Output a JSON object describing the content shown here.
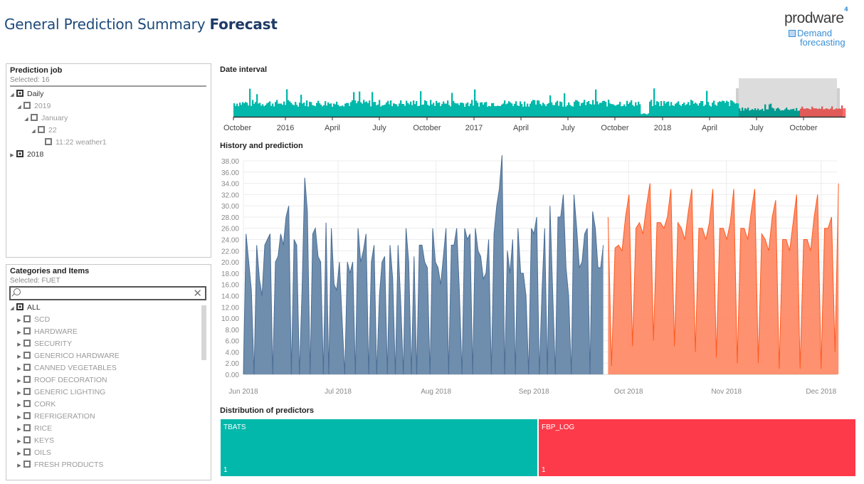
{
  "header": {
    "title_regular": "General Prediction Summary ",
    "title_bold": "Forecast"
  },
  "logo": {
    "brand": "prodware",
    "product_line1": "Demand",
    "product_line2": "forecasting"
  },
  "prediction_job": {
    "title": "Prediction job",
    "selected": "Selected: 16",
    "tree": [
      {
        "label": "Daily",
        "level": 0,
        "toggle": "expanded",
        "state": "partial",
        "dim": false
      },
      {
        "label": "2019",
        "level": 1,
        "toggle": "expanded",
        "state": "unchecked",
        "dim": true
      },
      {
        "label": "January",
        "level": 2,
        "toggle": "expanded",
        "state": "unchecked",
        "dim": true
      },
      {
        "label": "22",
        "level": 3,
        "toggle": "expanded",
        "state": "unchecked",
        "dim": true
      },
      {
        "label": "11:22 weather1",
        "level": 4,
        "toggle": "none",
        "state": "unchecked",
        "dim": true
      },
      {
        "label": "2018",
        "level": 0,
        "toggle": "collapsed",
        "state": "partial",
        "dim": false
      }
    ]
  },
  "categories": {
    "title": "Categories and Items",
    "selected": "Selected: FUET",
    "search_placeholder": "",
    "tree": [
      {
        "label": "ALL",
        "level": 0,
        "toggle": "expanded",
        "state": "partial",
        "dim": false
      },
      {
        "label": "SCD",
        "level": 1,
        "toggle": "collapsed",
        "state": "unchecked",
        "dim": true
      },
      {
        "label": "HARDWARE",
        "level": 1,
        "toggle": "collapsed",
        "state": "unchecked",
        "dim": true
      },
      {
        "label": "SECURITY",
        "level": 1,
        "toggle": "collapsed",
        "state": "unchecked",
        "dim": true
      },
      {
        "label": "GENERICO HARDWARE",
        "level": 1,
        "toggle": "collapsed",
        "state": "unchecked",
        "dim": true
      },
      {
        "label": "CANNED VEGETABLES",
        "level": 1,
        "toggle": "collapsed",
        "state": "unchecked",
        "dim": true
      },
      {
        "label": "ROOF DECORATION",
        "level": 1,
        "toggle": "collapsed",
        "state": "unchecked",
        "dim": true
      },
      {
        "label": "GENERIC LIGHTING",
        "level": 1,
        "toggle": "collapsed",
        "state": "unchecked",
        "dim": true
      },
      {
        "label": "CORK",
        "level": 1,
        "toggle": "collapsed",
        "state": "unchecked",
        "dim": true
      },
      {
        "label": "REFRIGERATION",
        "level": 1,
        "toggle": "collapsed",
        "state": "unchecked",
        "dim": true
      },
      {
        "label": "RICE",
        "level": 1,
        "toggle": "collapsed",
        "state": "unchecked",
        "dim": true
      },
      {
        "label": "KEYS",
        "level": 1,
        "toggle": "collapsed",
        "state": "unchecked",
        "dim": true
      },
      {
        "label": "OILS",
        "level": 1,
        "toggle": "collapsed",
        "state": "unchecked",
        "dim": true
      },
      {
        "label": "FRESH PRODUCTS",
        "level": 1,
        "toggle": "collapsed",
        "state": "unchecked",
        "dim": true
      }
    ]
  },
  "colors": {
    "teal": "#01b8aa",
    "teal_dark": "#019a8f",
    "red": "#fd3a4a",
    "red_soft": "#e05a57",
    "history": "#6f8eae",
    "history_line": "#4c6e96",
    "forecast": "#fe8b68",
    "forecast_line": "#ff5a1f",
    "brush": "#dcdcdc"
  },
  "chart_data": [
    {
      "id": "date_interval",
      "type": "bar",
      "title": "Date interval",
      "xlabel": "",
      "ylabel": "",
      "tick_labels": [
        "October",
        "2016",
        "April",
        "July",
        "October",
        "2017",
        "April",
        "July",
        "October",
        "2018",
        "April",
        "July",
        "October"
      ],
      "x_range": [
        "2015-10",
        "2018-12"
      ],
      "selection_range": [
        "2018-06",
        "2018-12"
      ],
      "series": [
        {
          "name": "History",
          "color": "#01b8aa",
          "range": [
            "2015-10",
            "2018-09"
          ]
        },
        {
          "name": "Prediction",
          "color": "#fd3a4a",
          "range": [
            "2018-09",
            "2018-12"
          ]
        }
      ]
    },
    {
      "id": "history_prediction",
      "type": "area",
      "title": "History and prediction",
      "xlabel": "",
      "ylabel": "",
      "ylim": [
        0,
        38
      ],
      "y_ticks": [
        "0.00",
        "2.00",
        "4.00",
        "6.00",
        "8.00",
        "10.00",
        "12.00",
        "14.00",
        "16.00",
        "18.00",
        "20.00",
        "22.00",
        "24.00",
        "26.00",
        "28.00",
        "30.00",
        "32.00",
        "34.00",
        "36.00",
        "38.00"
      ],
      "x_ticks": [
        "Jun 2018",
        "Jul 2018",
        "Aug 2018",
        "Sep 2018",
        "Oct 2018",
        "Nov 2018",
        "Dec 2018"
      ],
      "grid": true,
      "series": [
        {
          "name": "History",
          "start": "2018-06-01",
          "values": [
            0,
            25,
            20,
            15,
            0,
            23,
            17,
            14,
            23,
            24,
            25,
            0,
            20,
            21,
            25,
            23,
            28,
            30,
            0,
            24,
            23,
            0,
            15,
            35,
            29,
            0,
            25,
            26,
            21,
            20,
            0,
            27,
            0,
            26,
            16,
            15,
            20,
            10,
            0,
            20,
            18,
            20,
            0,
            26,
            20,
            22,
            25,
            0,
            20,
            23,
            0,
            14,
            20,
            21,
            0,
            23,
            17,
            0,
            23,
            13,
            0,
            26,
            20,
            0,
            21,
            0,
            23,
            23,
            20,
            19,
            0,
            26,
            20,
            19,
            16,
            21,
            26,
            0,
            23,
            23,
            26,
            15,
            0,
            26,
            24,
            25,
            0,
            26,
            22,
            21,
            17,
            18,
            24,
            0,
            25,
            30,
            33,
            39,
            0,
            22,
            18,
            24,
            0,
            26,
            18,
            18,
            14,
            0,
            26,
            25,
            28,
            0,
            15,
            26,
            0,
            30,
            15,
            0,
            28,
            28,
            32,
            19,
            14,
            0,
            32,
            26,
            19,
            20,
            25,
            26,
            0,
            29,
            26,
            19,
            19,
            23
          ]
        },
        {
          "name": "Prediction",
          "start": "2018-09-24",
          "values": [
            28,
            1.5,
            22.5,
            23,
            22,
            28,
            32,
            5,
            26,
            27,
            25,
            30,
            34,
            6,
            27,
            27,
            26,
            28,
            33,
            5,
            27,
            26,
            24,
            29,
            33,
            4,
            26,
            26,
            24,
            27,
            33,
            3,
            26,
            26,
            24,
            27,
            33,
            2,
            26,
            26,
            24,
            29,
            33,
            2,
            25,
            24,
            22,
            28,
            31,
            1,
            24,
            24,
            22,
            27,
            32,
            1,
            24,
            24,
            22,
            28,
            32,
            1,
            26,
            26,
            28,
            4,
            34
          ]
        }
      ]
    },
    {
      "id": "distribution_predictors",
      "type": "treemap",
      "title": "Distribution of predictors",
      "categories": [
        "TBATS",
        "FBP_LOG"
      ],
      "values": [
        1,
        1
      ],
      "colors": [
        "#01b8aa",
        "#fd3a4a"
      ]
    }
  ]
}
